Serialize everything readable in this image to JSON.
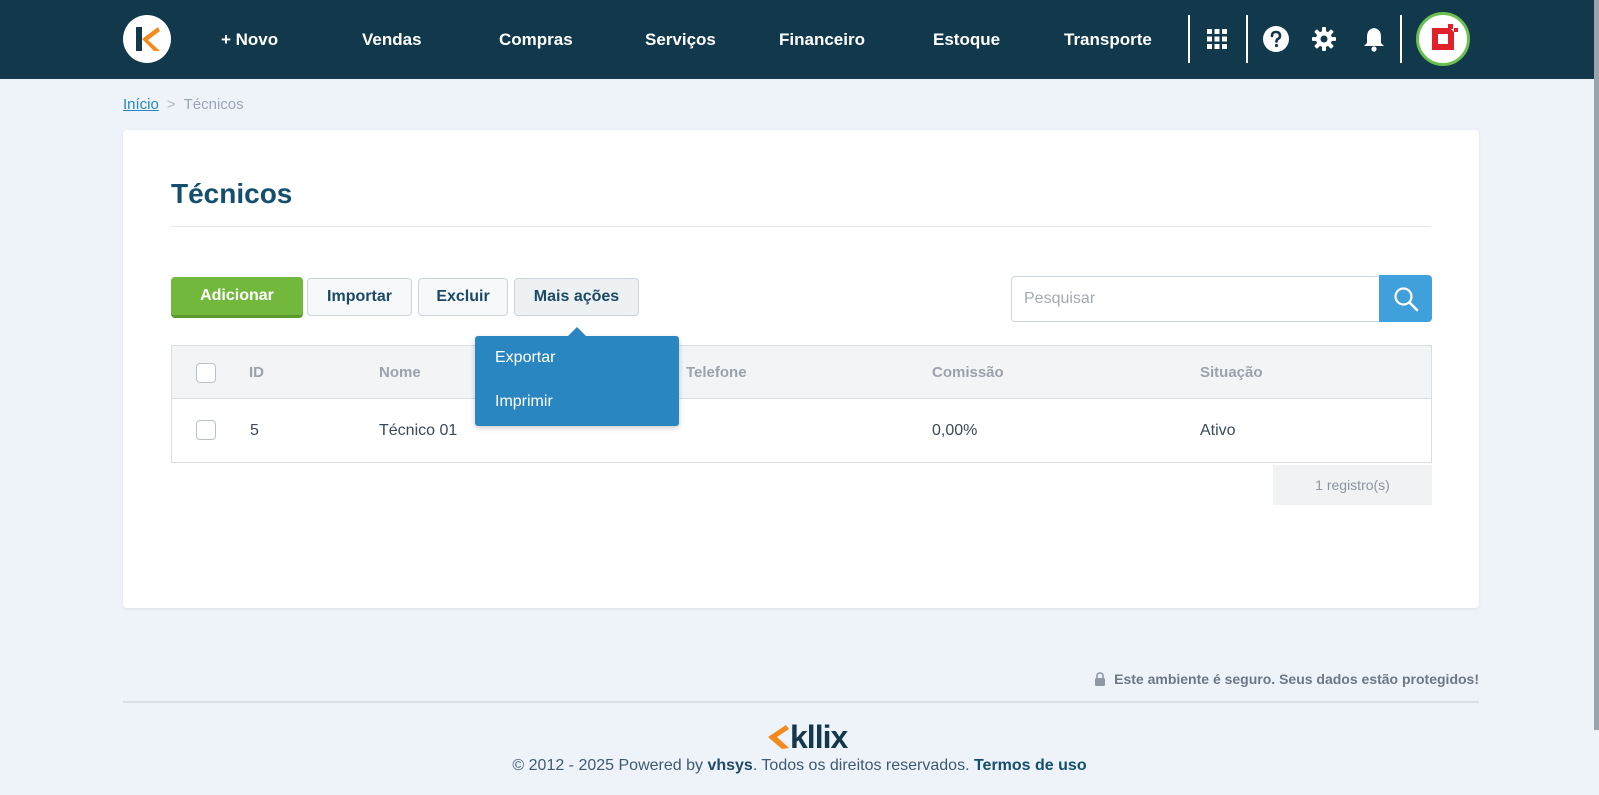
{
  "nav": {
    "items": [
      "+ Novo",
      "Vendas",
      "Compras",
      "Serviços",
      "Financeiro",
      "Estoque",
      "Transporte"
    ]
  },
  "breadcrumb": {
    "home": "Início",
    "separator": ">",
    "current": "Técnicos"
  },
  "page": {
    "title": "Técnicos"
  },
  "toolbar": {
    "add_label": "Adicionar",
    "import_label": "Importar",
    "delete_label": "Excluir",
    "more_label": "Mais ações"
  },
  "search": {
    "placeholder": "Pesquisar",
    "value": ""
  },
  "dropdown": {
    "items": [
      "Exportar",
      "Imprimir"
    ]
  },
  "table": {
    "columns": [
      "ID",
      "Nome",
      "Telefone",
      "Comissão",
      "Situação"
    ],
    "rows": [
      {
        "id": "5",
        "nome": "Técnico 01",
        "telefone": "",
        "comissao": "0,00%",
        "situacao": "Ativo"
      }
    ],
    "count": "1 registro(s)"
  },
  "footer": {
    "secure": "Este ambiente é seguro. Seus dados estão protegidos!",
    "logo": "kllix",
    "copyright_prefix": "© 2012 - 2025 Powered by",
    "brand": "vhsys",
    "copyright_suffix": ". Todos os direitos reservados.",
    "terms": "Termos de uso"
  },
  "colors": {
    "topbar": "#12384b",
    "accent_orange": "#f28a1e",
    "add_green": "#72b83c",
    "search_blue": "#40a0dc",
    "dropdown_blue": "#2a86c1",
    "title_blue": "#14506e"
  }
}
